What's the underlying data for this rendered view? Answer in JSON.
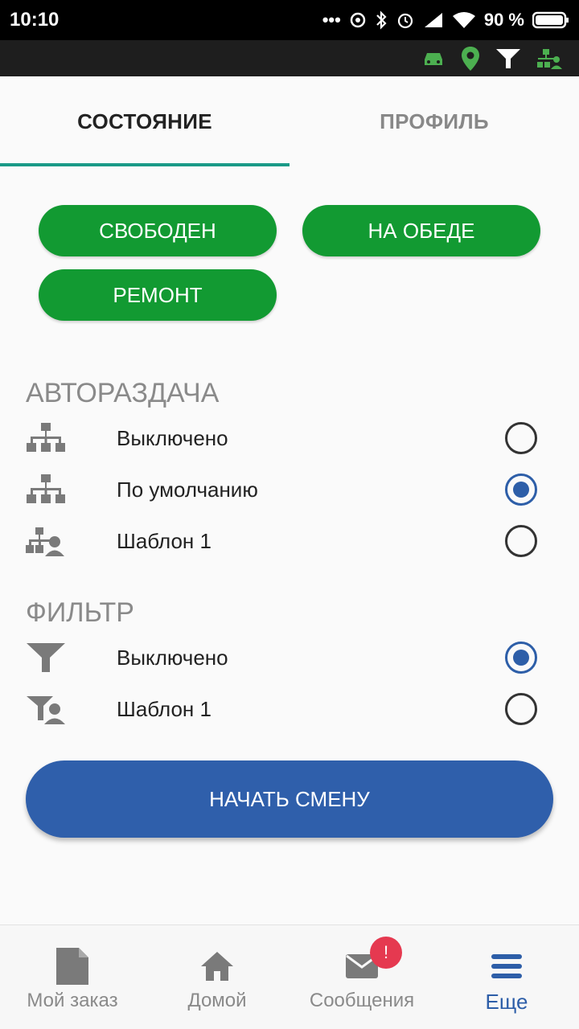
{
  "statusbar": {
    "time": "10:10",
    "battery": "90 %"
  },
  "toolbar": {
    "icons": [
      "car-icon",
      "location-pin-icon",
      "filter-icon",
      "hierarchy-user-icon"
    ],
    "accent": "#4caf50"
  },
  "tabs": [
    {
      "label": "СОСТОЯНИЕ",
      "active": true
    },
    {
      "label": "ПРОФИЛЬ",
      "active": false
    }
  ],
  "statuses": {
    "free": "СВОБОДЕН",
    "lunch": "НА ОБЕДЕ",
    "repair": "РЕМОНТ",
    "color": "#129a32"
  },
  "autodistribution": {
    "title": "АВТОРАЗДАЧА",
    "options": [
      {
        "label": "Выключено",
        "checked": false
      },
      {
        "label": "По умолчанию",
        "checked": true
      },
      {
        "label": "Шаблон 1",
        "checked": false
      }
    ]
  },
  "filter": {
    "title": "ФИЛЬТР",
    "options": [
      {
        "label": "Выключено",
        "checked": true
      },
      {
        "label": "Шаблон 1",
        "checked": false
      }
    ]
  },
  "start_shift": "НАЧАТЬ СМЕНУ",
  "bottomnav": {
    "items": [
      {
        "label": "Мой заказ",
        "icon": "document-icon"
      },
      {
        "label": "Домой",
        "icon": "home-icon"
      },
      {
        "label": "Сообщения",
        "icon": "mail-icon",
        "badge": "!"
      },
      {
        "label": "Еще",
        "icon": "menu-icon",
        "active": true
      }
    ]
  },
  "colors": {
    "accent_blue": "#2d5ea8",
    "tab_indicator": "#1a9a87",
    "badge_red": "#e53950"
  }
}
